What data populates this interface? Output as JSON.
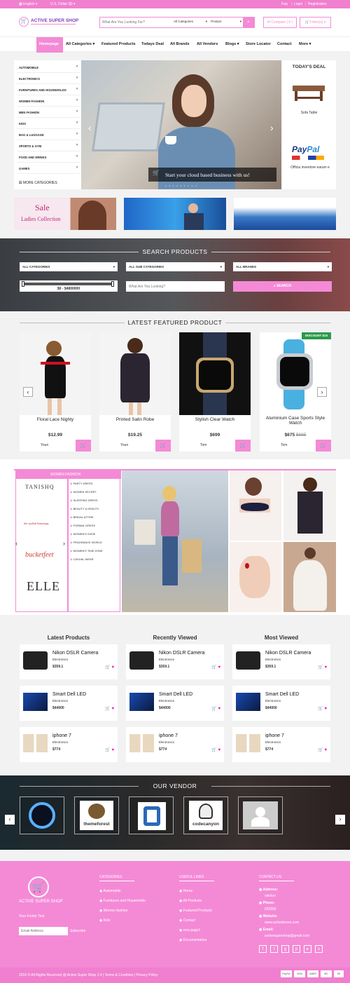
{
  "topbar": {
    "language": "English",
    "currency": "U.S. Dollar ($)",
    "faq": "Faq",
    "login": "Login",
    "registration": "Registration"
  },
  "header": {
    "logo_text": "ACTIVE SUPER SHOP",
    "search_placeholder": "What Are You Looking For?",
    "category_select": "All Categories",
    "type_select": "Product",
    "compare": "Compare ( 0 )",
    "cart": "0 item(s)"
  },
  "nav": {
    "items": [
      "Homepage",
      "All Categories",
      "Featured Products",
      "Todays Deal",
      "All Brands",
      "All Vendors",
      "Blogs",
      "Store Locator",
      "Contact",
      "More"
    ]
  },
  "categories": {
    "items": [
      "AUTOMOBILE",
      "ELECTRONICS",
      "FURNITURES AND HOUSEHOLDS",
      "WOMEN FASHION",
      "MEN FASHION",
      "KIDS",
      "BAG & LUGGAGE",
      "SPORTS & GYM",
      "FOOD AND DRINKS",
      "GAMES"
    ],
    "more": "MORE CATEGORIES"
  },
  "slider": {
    "caption": "Start your cloud based business with us!"
  },
  "todays_deal": {
    "title": "TODAY'S DEAL",
    "items": [
      "Sofa Table",
      "Officia inventore earum e"
    ]
  },
  "banners": {
    "sale_title": "Sale",
    "sale_sub": "Ladies Collection"
  },
  "search_products": {
    "title": "SEARCH PRODUCTS",
    "category": "ALL CATEGORIES",
    "sub_category": "ALL SUB CATEGORIES",
    "brand": "ALL BRANDS",
    "price_range": "$0 - $4800000",
    "input_placeholder": "What Are You Looking?",
    "button": "SEARCH"
  },
  "featured": {
    "title": "LATEST FEATURED PRODUCT",
    "products": [
      {
        "name": "Floral Lace Nighty",
        "price": "$12.99",
        "old_price": "",
        "vendor": "Youn"
      },
      {
        "name": "Printed Satin Robe",
        "price": "$19.25",
        "old_price": "",
        "vendor": "Youn"
      },
      {
        "name": "Stylish Clear Watch",
        "price": "$699",
        "old_price": "",
        "vendor": "Tom"
      },
      {
        "name": "Aluminium Case Sports Style Watch",
        "price": "$675",
        "old_price": "$685",
        "vendor": "Tom"
      }
    ],
    "badge": "DISCOUNT $10"
  },
  "women_fashion": {
    "title": "WOMEN FASHION",
    "brands": [
      "TANISHQ",
      "the stylish batwings",
      "bucketfeet",
      "ELLE"
    ],
    "subcats": [
      "PARTY DRESS",
      "WOMEN SECRET",
      "SLEEPING DRESS",
      "BEAUTY & HEALTH",
      "BRIDAL ATTIRE",
      "FORMAL DRESS",
      "WOMEN'S SHOE",
      "FRAGRANCE WORLD",
      "WOMEN'S TIME ZONE",
      "CASUAL WEAR"
    ]
  },
  "lists": [
    {
      "title": "Latest Products",
      "items": [
        {
          "name": "Nikon DSLR Camera",
          "cat": "Electronics",
          "price": "$359.1"
        },
        {
          "name": "Smart Dell LED",
          "cat": "Electronics",
          "price": "$44000"
        },
        {
          "name": "iphone 7",
          "cat": "Electronics",
          "price": "$774"
        }
      ]
    },
    {
      "title": "Recently Viewed",
      "items": [
        {
          "name": "Nikon DSLR Camera",
          "cat": "Electronics",
          "price": "$359.1"
        },
        {
          "name": "Smart Dell LED",
          "cat": "Electronics",
          "price": "$44000"
        },
        {
          "name": "iphone 7",
          "cat": "Electronics",
          "price": "$774"
        }
      ]
    },
    {
      "title": "Most Viewed",
      "items": [
        {
          "name": "Nikon DSLR Camera",
          "cat": "Electronics",
          "price": "$359.1"
        },
        {
          "name": "Smart Dell LED",
          "cat": "Electronics",
          "price": "$44000"
        },
        {
          "name": "iphone 7",
          "cat": "Electronics",
          "price": "$774"
        }
      ]
    }
  ],
  "vendors": {
    "title": "OUR VENDOR",
    "names": [
      "themeforest",
      "codecanyon"
    ]
  },
  "footer": {
    "logo_text": "ACTIVE SUPER SHOP",
    "footer_text": "Your Footer Text",
    "email_placeholder": "Email Address",
    "subscribe": "Subscribe",
    "categories_title": "CATEGORIES",
    "categories": [
      "Automobile",
      "Furnitures and Households",
      "Women fashion",
      "Kids"
    ],
    "links_title": "USEFUL LINKS",
    "links": [
      "Home",
      "All Products",
      "Featured Products",
      "Contact",
      "new page1",
      "Documentation"
    ],
    "contact_title": "CONTACT US",
    "address_label": "Address:",
    "address": "nikolon",
    "phone_label": "Phone:",
    "phone": "022555",
    "website_label": "Website:",
    "website": "www.activeitzone.com",
    "email_label": "Email:",
    "email": "activesupershop@gmail.com",
    "copyright": "2016 © All Rights Reserved @ Active Super Shop 1.4 | Terms & Condition | Privacy Policy",
    "payments": [
      "PayPal",
      "VISA",
      "AMEX",
      "MC",
      "SK"
    ]
  },
  "colors": {
    "accent": "#f48ad6",
    "topbar": "#f07fcf"
  }
}
